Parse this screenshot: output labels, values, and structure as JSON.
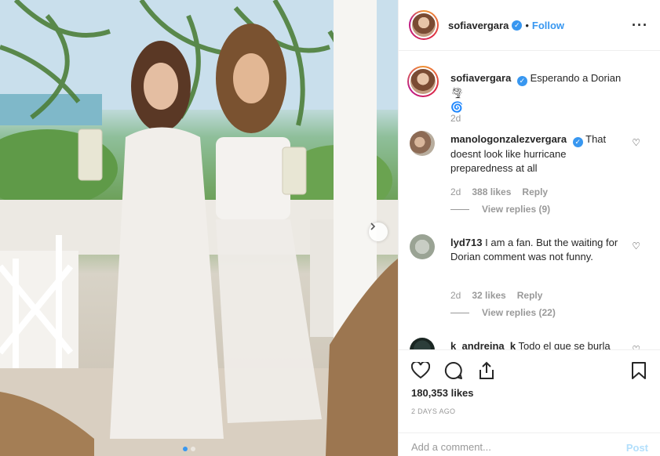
{
  "post": {
    "username": "sofiavergara",
    "bullet": "•",
    "follow_label": "Follow",
    "more_icon": "more-options-icon"
  },
  "caption": {
    "username": "sofiavergara",
    "text": "Esperando a Dorian",
    "emoji": "🌪",
    "date": "2d"
  },
  "comments": [
    {
      "username": "manologonzalezvergara",
      "verified": true,
      "text": "That doesnt look like hurricane preparedness at all",
      "date": "2d",
      "likes": "388 likes",
      "reply_label": "Reply",
      "view_replies": "View replies (9)"
    },
    {
      "username": "lyd713",
      "verified": false,
      "text": "I am a fan. But the waiting for Dorian comment was not funny.",
      "date": "2d",
      "likes": "32 likes",
      "reply_label": "Reply",
      "view_replies": "View replies (22)"
    },
    {
      "username": "k_andreina_k",
      "verified": false,
      "text": "Todo el que se burla"
    }
  ],
  "footer": {
    "likes": "180,353 likes",
    "time_ago": "2 DAYS AGO",
    "comment_placeholder": "Add a comment...",
    "post_label": "Post"
  },
  "colors": {
    "accent": "#3897f0",
    "muted": "#999999",
    "post_disabled": "#b2dffc"
  }
}
